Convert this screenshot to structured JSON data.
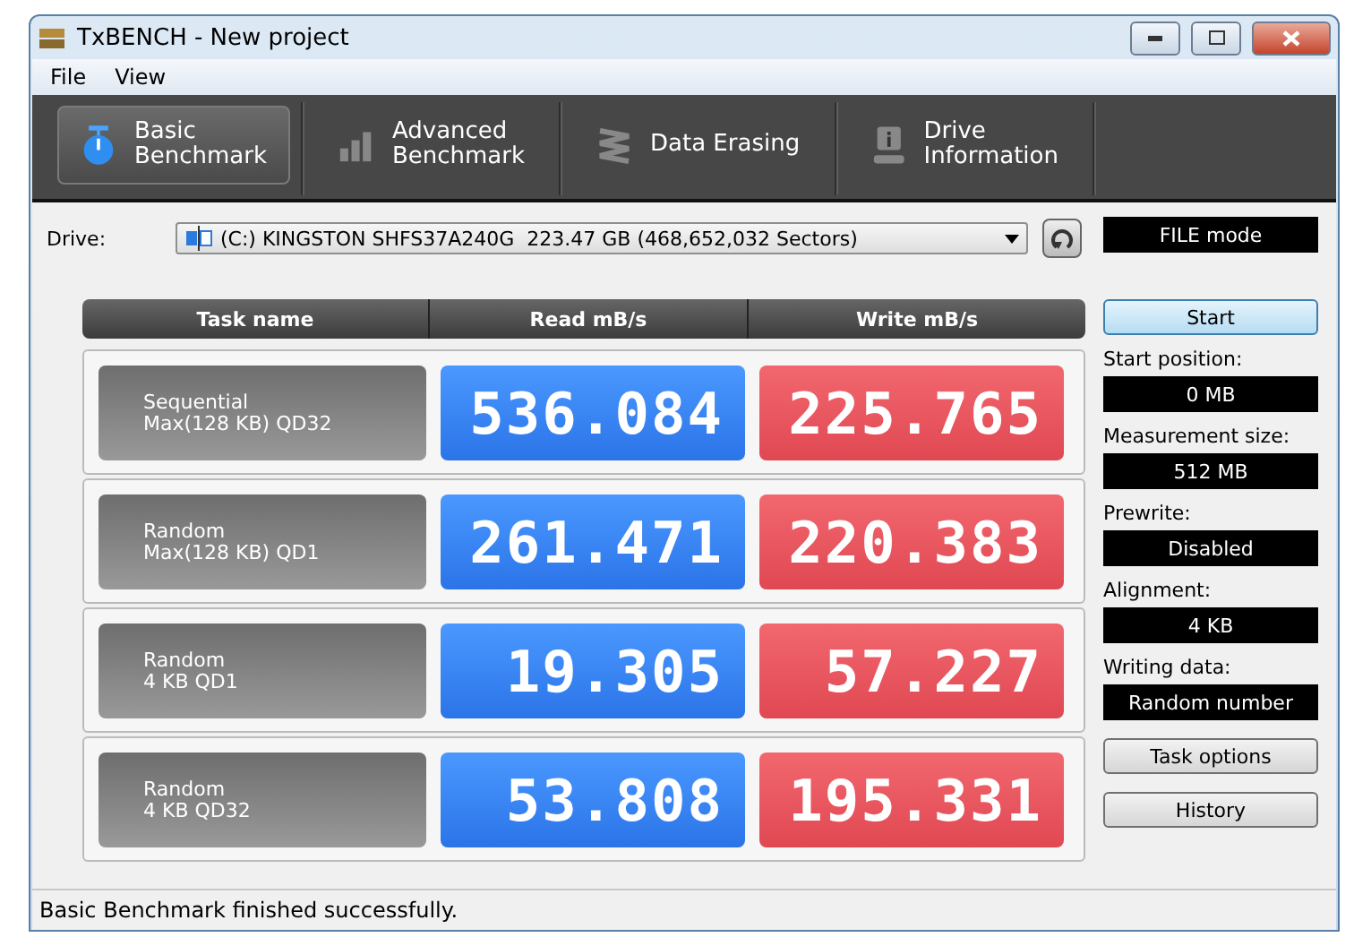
{
  "window": {
    "title": "TxBENCH - New project"
  },
  "menu": [
    "File",
    "View"
  ],
  "tabs": [
    {
      "label": "Basic\nBenchmark",
      "selected": true
    },
    {
      "label": "Advanced\nBenchmark",
      "selected": false
    },
    {
      "label": "Data Erasing",
      "selected": false
    },
    {
      "label": "Drive\nInformation",
      "selected": false
    }
  ],
  "drive": {
    "label": "Drive:",
    "value": "(C:) KINGSTON SHFS37A240G  223.47 GB (468,652,032 Sectors)"
  },
  "mode": "FILE mode",
  "table": {
    "columns": [
      "Task name",
      "Read mB/s",
      "Write mB/s"
    ],
    "rows": [
      {
        "name": "Sequential",
        "detail": "Max(128 KB) QD32",
        "read": "536.084",
        "write": "225.765"
      },
      {
        "name": "Random",
        "detail": "Max(128 KB) QD1",
        "read": "261.471",
        "write": "220.383"
      },
      {
        "name": "Random",
        "detail": "4 KB QD1",
        "read": "19.305",
        "write": "57.227"
      },
      {
        "name": "Random",
        "detail": "4 KB QD32",
        "read": "53.808",
        "write": "195.331"
      }
    ]
  },
  "start_button": "Start",
  "settings": [
    {
      "label": "Start position:",
      "value": "0 MB"
    },
    {
      "label": "Measurement size:",
      "value": "512 MB"
    },
    {
      "label": "Prewrite:",
      "value": "Disabled"
    },
    {
      "label": "Alignment:",
      "value": "4 KB"
    },
    {
      "label": "Writing data:",
      "value": "Random number"
    }
  ],
  "buttons": [
    "Task options",
    "History"
  ],
  "status_bar": "Basic Benchmark finished successfully."
}
